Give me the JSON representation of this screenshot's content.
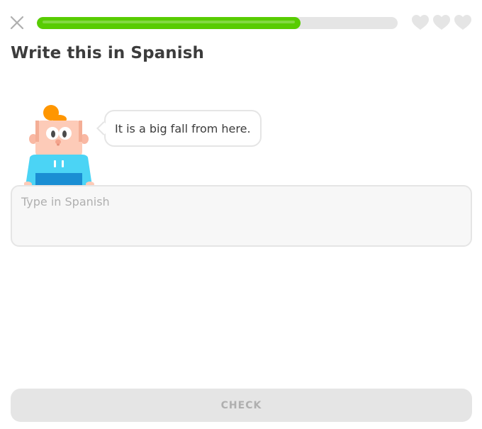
{
  "header": {
    "close_icon": "close-icon",
    "progress_fraction": 0.73,
    "progress_color": "#58cc02",
    "track_color": "#e5e5e5",
    "hearts_count": 3,
    "heart_icon": "heart-icon",
    "heart_color": "#e5e5e5"
  },
  "exercise": {
    "title": "Write this in Spanish",
    "prompt_sentence": "It is a big fall from here.",
    "character_icon": "character-avatar"
  },
  "answer": {
    "placeholder": "Type in Spanish",
    "value": ""
  },
  "footer": {
    "check_label": "CHECK",
    "check_disabled": true
  }
}
